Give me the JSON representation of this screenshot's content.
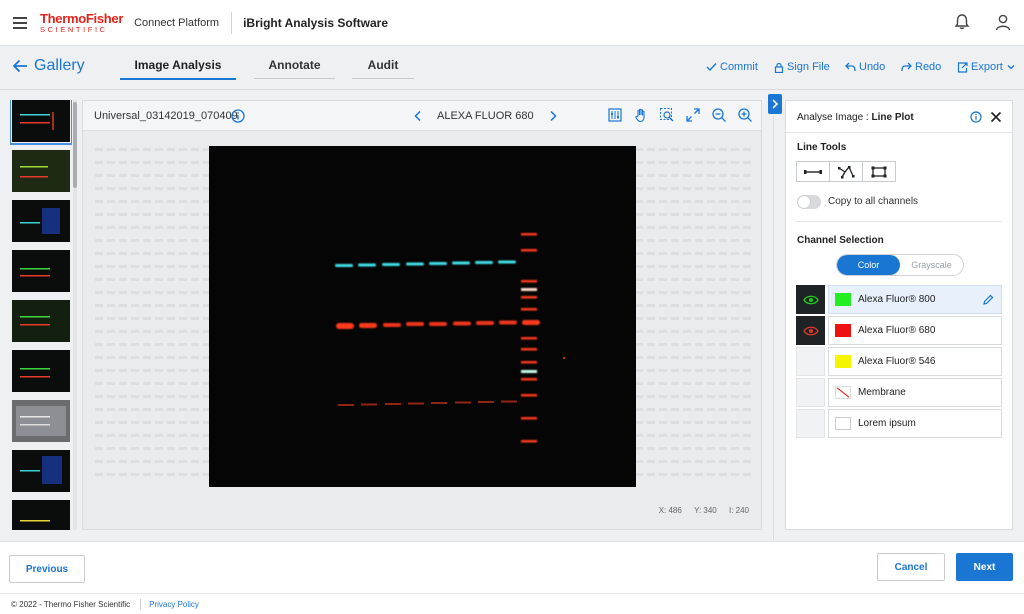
{
  "header": {
    "brand_line1": "ThermoFisher",
    "brand_line2": "SCIENTIFIC",
    "platform": "Connect Platform",
    "app_name": "iBright Analysis Software"
  },
  "subnav": {
    "gallery_label": "Gallery",
    "tabs": [
      {
        "label": "Image Analysis",
        "active": true
      },
      {
        "label": "Annotate",
        "active": false
      },
      {
        "label": "Audit",
        "active": false
      }
    ],
    "actions": {
      "commit": "Commit",
      "sign_file": "Sign File",
      "undo": "Undo",
      "redo": "Redo",
      "export": "Export"
    }
  },
  "viewer": {
    "image_name": "Universal_03142019_070409",
    "channel_name": "ALEXA FLUOR 680",
    "coords": {
      "x": "X: 486",
      "y": "Y: 340",
      "i": "I: 240"
    }
  },
  "panel": {
    "title_prefix": "Analyse Image : ",
    "title_mode": "Line Plot",
    "line_tools_label": "Line Tools",
    "copy_label": "Copy to all channels",
    "copy_enabled": false,
    "channel_selection_label": "Channel Selection",
    "mode_color": "Color",
    "mode_grayscale": "Grayscale",
    "channels": [
      {
        "name": "Alexa Fluor® 800",
        "color": "#22ee22",
        "visible": true,
        "eye_color": "#1fcf1f",
        "selected": true
      },
      {
        "name": "Alexa Fluor® 680",
        "color": "#ee1111",
        "visible": true,
        "eye_color": "#e0392b",
        "selected": false
      },
      {
        "name": "Alexa Fluor® 546",
        "color": "#f5f500",
        "visible": false,
        "selected": false
      },
      {
        "name": "Membrane",
        "color": "none",
        "visible": false,
        "selected": false
      },
      {
        "name": "Lorem ipsum",
        "color": "#ffffff",
        "visible": false,
        "selected": false
      }
    ]
  },
  "footer_bar": {
    "previous": "Previous",
    "cancel": "Cancel",
    "next": "Next"
  },
  "footer": {
    "copyright": "© 2022 - Thermo Fisher Scientific",
    "privacy": "Privacy Policy"
  },
  "colors": {
    "accent": "#1976d2",
    "brand_red": "#e2231a"
  }
}
